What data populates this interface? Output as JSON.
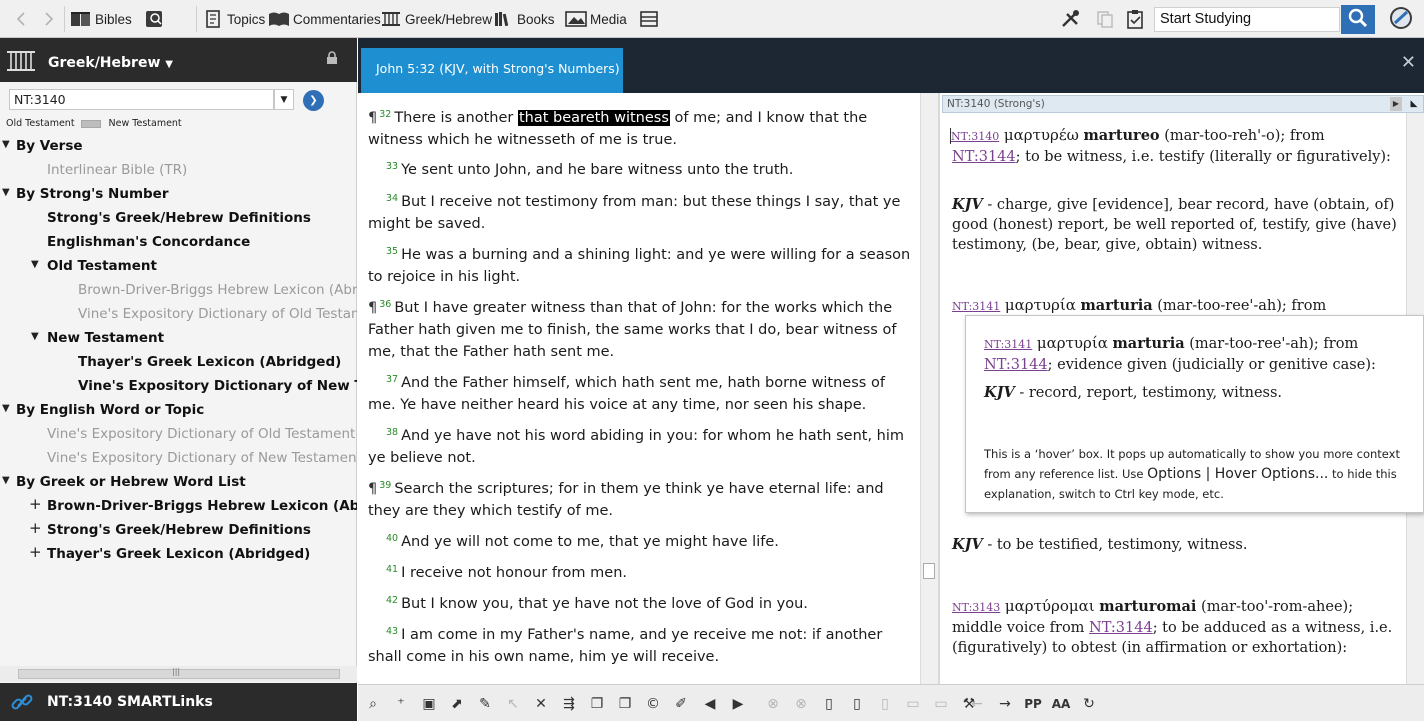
{
  "toolbar": {
    "bibles": "Bibles",
    "topics": "Topics",
    "commentaries": "Commentaries",
    "greek_hebrew": "Greek/Hebrew",
    "books": "Books",
    "media": "Media",
    "search_value": "Start Studying"
  },
  "left": {
    "title": "Greek/Hebrew",
    "reference": "NT:3140",
    "old_testament": "Old Testament",
    "new_testament": "New Testament",
    "tree": [
      {
        "label": "By Verse",
        "twisty": "▼",
        "style": "bold"
      },
      {
        "label": "Interlinear Bible (TR)",
        "twisty": "",
        "style": "grey"
      },
      {
        "label": "By Strong's Number",
        "twisty": "▼",
        "style": "bold"
      },
      {
        "label": "Strong's Greek/Hebrew Definitions",
        "twisty": "",
        "style": "bold"
      },
      {
        "label": "Englishman's Concordance",
        "twisty": "",
        "style": "bold"
      },
      {
        "label": "Old Testament",
        "twisty": "▼",
        "style": "bold"
      },
      {
        "label": "Brown-Driver-Briggs Hebrew Lexicon (Abridged)",
        "twisty": "",
        "style": "grey"
      },
      {
        "label": "Vine's Expository Dictionary of Old Testament Words",
        "twisty": "",
        "style": "grey"
      },
      {
        "label": "New Testament",
        "twisty": "▼",
        "style": "bold"
      },
      {
        "label": "Thayer's Greek Lexicon (Abridged)",
        "twisty": "",
        "style": "bold"
      },
      {
        "label": "Vine's Expository Dictionary of New Testament Words",
        "twisty": "",
        "style": "bold"
      },
      {
        "label": "By English Word or Topic",
        "twisty": "▼",
        "style": "bold"
      },
      {
        "label": "Vine's Expository Dictionary of Old Testament Words",
        "twisty": "",
        "style": "grey"
      },
      {
        "label": "Vine's Expository Dictionary of New Testament Words",
        "twisty": "",
        "style": "grey"
      },
      {
        "label": "By Greek or Hebrew Word List",
        "twisty": "▼",
        "style": "bold"
      },
      {
        "label": "Brown-Driver-Briggs Hebrew Lexicon (Abridged)",
        "twisty": "+",
        "style": "bold"
      },
      {
        "label": "Strong's Greek/Hebrew Definitions",
        "twisty": "+",
        "style": "bold"
      },
      {
        "label": "Thayer's Greek Lexicon (Abridged)",
        "twisty": "+",
        "style": "bold"
      }
    ],
    "footer": "NT:3140 SMARTLinks"
  },
  "main": {
    "tab": "John 5:32 (KJV, with Strong's Numbers)",
    "verses": [
      {
        "num": "32",
        "pilcrow": "¶",
        "pre": "There is another ",
        "hl": "that beareth witness",
        "post": " of me; and I know that the witness which he witnesseth of me is true."
      },
      {
        "num": "33",
        "pilcrow": "",
        "pre": "Ye sent unto John, and he bare witness unto the truth.",
        "hl": "",
        "post": ""
      },
      {
        "num": "34",
        "pilcrow": "",
        "pre": "But I receive not testimony from man: but these things I say, that ye might be saved.",
        "hl": "",
        "post": ""
      },
      {
        "num": "35",
        "pilcrow": "",
        "pre": "He was a burning and a shining light: and ye were willing for a season to rejoice in his light.",
        "hl": "",
        "post": ""
      },
      {
        "num": "36",
        "pilcrow": "¶",
        "pre": "But I have greater witness than that of John: for the works which the Father hath given me to finish, the same works that I do, bear witness of me, that the Father hath sent me.",
        "hl": "",
        "post": ""
      },
      {
        "num": "37",
        "pilcrow": "",
        "pre": "And the Father himself, which hath sent me, hath borne witness of me. Ye have neither heard his voice at any time, nor seen his shape.",
        "hl": "",
        "post": ""
      },
      {
        "num": "38",
        "pilcrow": "",
        "pre": "And ye have not his word abiding in you: for whom he hath sent, him ye believe not.",
        "hl": "",
        "post": ""
      },
      {
        "num": "39",
        "pilcrow": "¶",
        "pre": "Search the scriptures; for in them ye think ye have eternal life: and they are they which testify of me.",
        "hl": "",
        "post": ""
      },
      {
        "num": "40",
        "pilcrow": "",
        "pre": "And ye will not come to me, that ye might have life.",
        "hl": "",
        "post": ""
      },
      {
        "num": "41",
        "pilcrow": "",
        "pre": "I receive not honour from men.",
        "hl": "",
        "post": ""
      },
      {
        "num": "42",
        "pilcrow": "",
        "pre": "But I know you, that ye have not the love of God in you.",
        "hl": "",
        "post": ""
      },
      {
        "num": "43",
        "pilcrow": "",
        "pre": "I am come in my Father's name, and ye receive me not: if another shall come in his own name, him ye will receive.",
        "hl": "",
        "post": ""
      }
    ]
  },
  "right": {
    "header": "NT:3140 (Strong's)",
    "entry1": {
      "num": "NT:3140",
      "greek": "μαρτυρέω",
      "translit": "martureo",
      "pron": " (mar-too-reh'-o); from ",
      "ref": "NT:3144",
      "def": "; to be witness, i.e. testify (literally or figuratively):",
      "kjv": "KJV",
      "kjv_text": " - charge, give [evidence], bear record, have (obtain, of) good (honest) report, be well reported of, testify, give (have) testimony, (be, bear, give, obtain) witness."
    },
    "entry2": {
      "num": "NT:3141",
      "greek": "μαρτυρία",
      "translit": "marturia",
      "pron": " (mar-too-ree'-ah); from"
    },
    "entry2b_kjv": "KJV",
    "entry2b_text": " - to be testified, testimony, witness.",
    "entry3": {
      "num": "NT:3143",
      "greek": "μαρτύρομαι",
      "translit": "marturomai",
      "pron": " (mar-too'-rom-ahee); middle voice from ",
      "ref": "NT:3144",
      "def": "; to be adduced as a witness, i.e. (figuratively) to obtest (in affirmation or exhortation):"
    }
  },
  "hover": {
    "num": "NT:3141",
    "greek": "μαρτυρία",
    "translit": "marturia",
    "pron": " (mar-too-ree'-ah); from ",
    "ref": "NT:3144",
    "def": "; evidence given (judicially or genitive case):",
    "kjv": "KJV",
    "kjv_text": " - record, report, testimony, witness.",
    "note_1": "This is a ‘hover’ box.  It pops up automatically to show you more context from any reference list.  Use ",
    "note_options": "Options",
    "note_sep": " | ",
    "note_hover": "Hover Options...",
    "note_2": " to hide this explanation, switch to Ctrl key mode, etc."
  }
}
